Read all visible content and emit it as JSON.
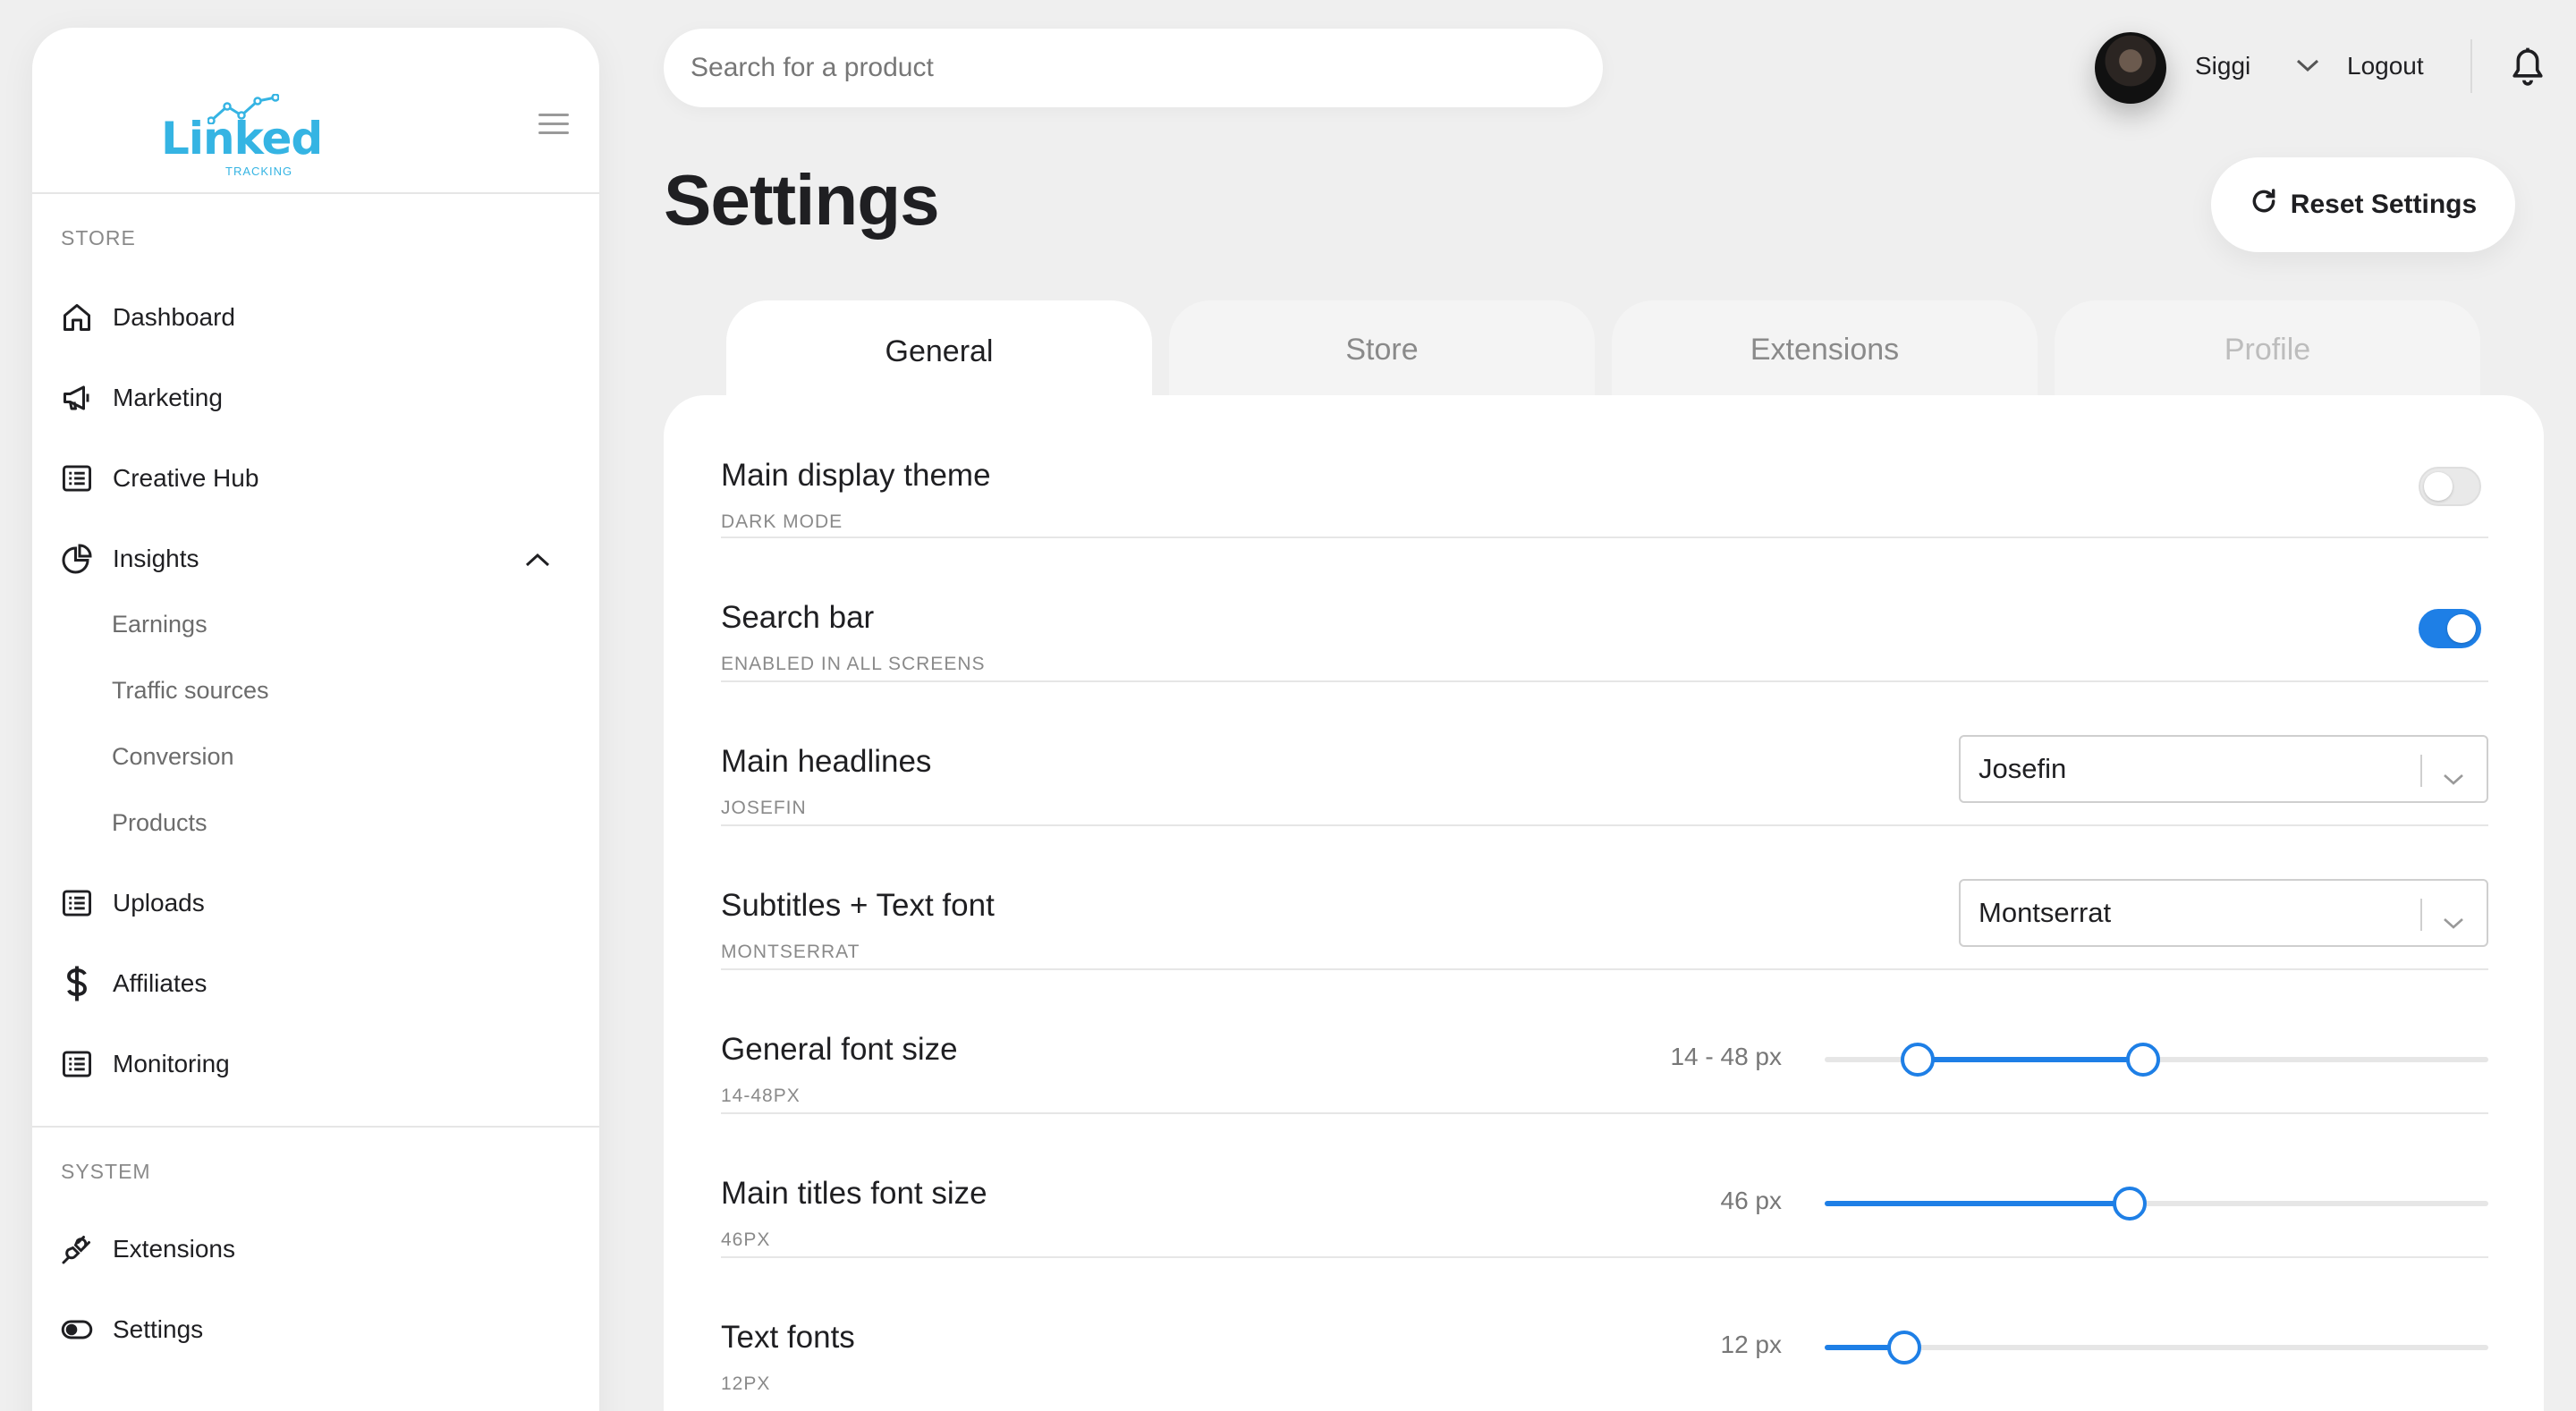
{
  "brand": {
    "name": "Linked",
    "tagline": "TRACKING"
  },
  "sidebar": {
    "store_section": "STORE",
    "items": [
      {
        "label": "Dashboard",
        "icon": "home-icon"
      },
      {
        "label": "Marketing",
        "icon": "megaphone-icon"
      },
      {
        "label": "Creative Hub",
        "icon": "list-icon"
      },
      {
        "label": "Insights",
        "icon": "pie-chart-icon",
        "expanded": true
      }
    ],
    "insights_sub": [
      "Earnings",
      "Traffic sources",
      "Conversion",
      "Products"
    ],
    "items2": [
      {
        "label": "Uploads",
        "icon": "list-icon"
      },
      {
        "label": "Affiliates",
        "icon": "dollar-icon"
      },
      {
        "label": "Monitoring",
        "icon": "list-icon"
      }
    ],
    "system_section": "SYSTEM",
    "system_items": [
      {
        "label": "Extensions",
        "icon": "plug-icon"
      },
      {
        "label": "Settings",
        "icon": "toggle-icon"
      }
    ]
  },
  "header": {
    "search_placeholder": "Search for a product",
    "username": "Siggi",
    "logout": "Logout"
  },
  "page": {
    "title": "Settings",
    "reset_label": "Reset Settings",
    "tabs": [
      "General",
      "Store",
      "Extensions",
      "Profile"
    ],
    "active_tab": "General"
  },
  "settings": {
    "theme": {
      "label": "Main display theme",
      "sub": "DARK MODE",
      "on": false
    },
    "searchbar": {
      "label": "Search bar",
      "sub": "ENABLED IN ALL SCREENS",
      "on": true
    },
    "headlines": {
      "label": "Main headlines",
      "sub": "JOSEFIN",
      "value": "Josefin"
    },
    "subtitles": {
      "label": "Subtitles + Text font",
      "sub": "MONTSERRAT",
      "value": "Montserrat"
    },
    "fontsize": {
      "label": "General font size",
      "sub": "14-48PX",
      "value_text": "14 - 48 px",
      "range_min": 0.14,
      "range_max": 0.48
    },
    "titlesize": {
      "label": "Main titles font size",
      "sub": "46PX",
      "value_text": "46 px",
      "value": 0.46
    },
    "textfonts": {
      "label": "Text fonts",
      "sub": "12PX",
      "value_text": "12 px",
      "value": 0.12
    }
  },
  "colors": {
    "accent": "#1e7fe6",
    "brand": "#35b4e3"
  }
}
